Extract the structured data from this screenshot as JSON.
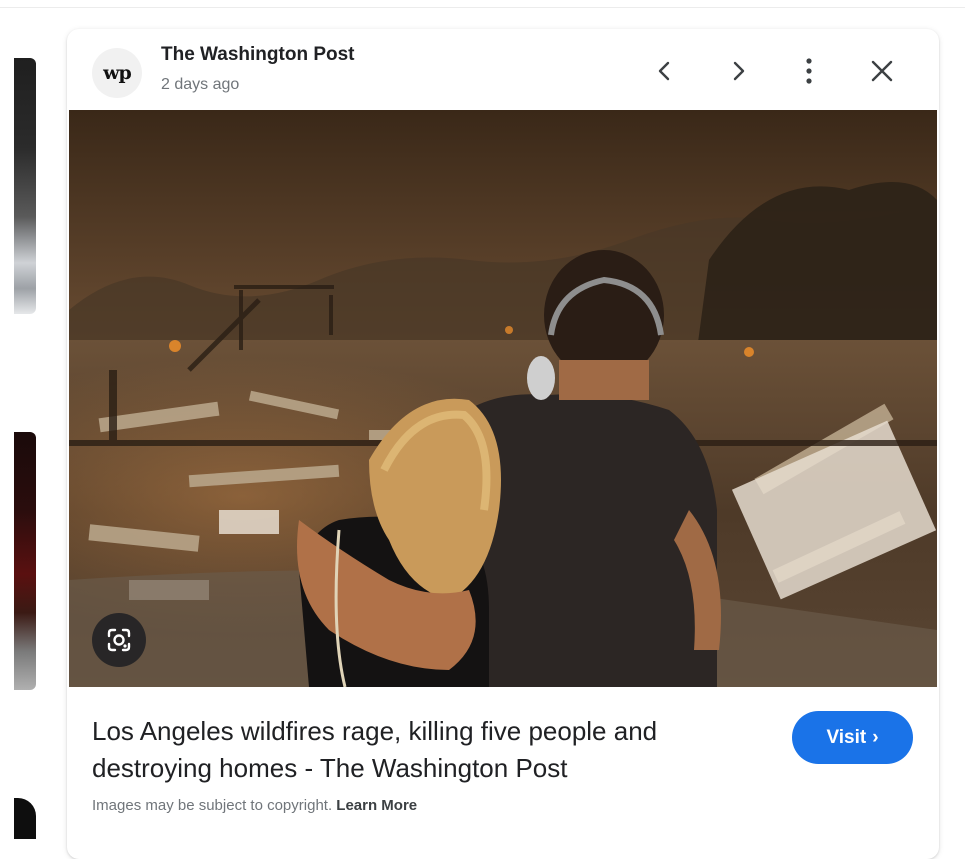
{
  "source": {
    "logo_text": "wp",
    "name": "The Washington Post",
    "time": "2 days ago"
  },
  "header_icons": [
    "chevron-left-icon",
    "chevron-right-icon",
    "more-vert-icon",
    "close-icon"
  ],
  "image": {
    "description_tag": "wildfire-photo"
  },
  "article": {
    "title": "Los Angeles wildfires rage, killing five people and destroying homes - The Washington Post",
    "visit_label": "Visit",
    "visit_chevron": "›"
  },
  "footer": {
    "copyright_text": "Images may be subject to copyright.",
    "learn_more": "Learn More"
  },
  "colors": {
    "accent": "#1a73e8",
    "text_primary": "#202124",
    "text_secondary": "#70757a"
  }
}
